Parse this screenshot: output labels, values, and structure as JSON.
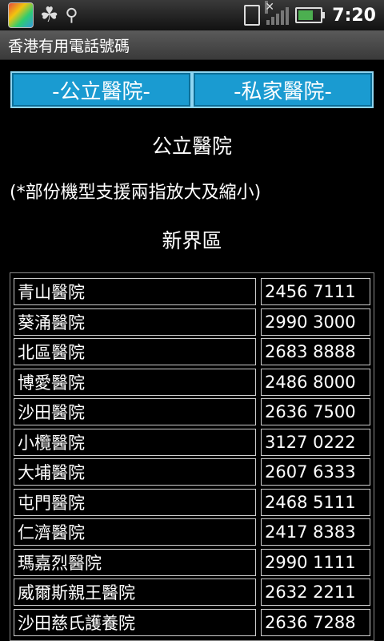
{
  "statusbar": {
    "time": "7:20"
  },
  "app": {
    "title": "香港有用電話號碼"
  },
  "tabs": [
    {
      "label": "-公立醫院-"
    },
    {
      "label": "-私家醫院-"
    }
  ],
  "section": {
    "title": "公立醫院",
    "note": "(*部份機型支援兩指放大及縮小)",
    "region": "新界區"
  },
  "hospitals": [
    {
      "name": "青山醫院",
      "phone": "2456 7111"
    },
    {
      "name": "葵涌醫院",
      "phone": "2990 3000"
    },
    {
      "name": "北區醫院",
      "phone": "2683 8888"
    },
    {
      "name": "博愛醫院",
      "phone": "2486 8000"
    },
    {
      "name": "沙田醫院",
      "phone": "2636 7500"
    },
    {
      "name": "小欖醫院",
      "phone": "3127 0222"
    },
    {
      "name": "大埔醫院",
      "phone": "2607 6333"
    },
    {
      "name": "屯門醫院",
      "phone": "2468 5111"
    },
    {
      "name": "仁濟醫院",
      "phone": "2417 8383"
    },
    {
      "name": "瑪嘉烈醫院",
      "phone": "2990 1111"
    },
    {
      "name": "威爾斯親王醫院",
      "phone": "2632 2211"
    },
    {
      "name": "沙田慈氏護養院",
      "phone": "2636 7288"
    }
  ]
}
